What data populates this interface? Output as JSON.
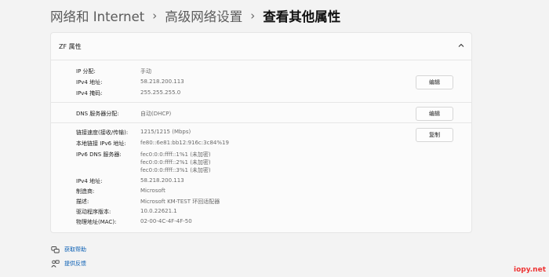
{
  "breadcrumb": {
    "items": [
      {
        "label": "网络和 Internet"
      },
      {
        "label": "高级网络设置"
      },
      {
        "label": "查看其他属性"
      }
    ],
    "separator": "›"
  },
  "panel": {
    "title": "ZF 属性",
    "section1": {
      "ip_label": "IP 分配:",
      "ip_value": "手动",
      "ipv4_label": "IPv4 地址:",
      "ipv4_value": "58.218.200.113",
      "mask_label": "IPv4 掩码:",
      "mask_value": "255.255.255.0",
      "edit_label": "编辑"
    },
    "section2": {
      "dns_label": "DNS 服务器分配:",
      "dns_value": "自动(DHCP)",
      "edit_label": "编辑"
    },
    "section3": {
      "copy_label": "复制",
      "link_speed_label": "链接速度(接收/传输):",
      "link_speed_value": "1215/1215 (Mbps)",
      "ipv6_local_label": "本地链接 IPv6 地址:",
      "ipv6_local_value": "fe80::6e81:bb12:916c:3c84%19",
      "ipv6_dns_label": "IPv6 DNS 服务器:",
      "ipv6_dns_values": [
        "fec0:0:0:ffff::1%1 (未加密)",
        "fec0:0:0:ffff::2%1 (未加密)",
        "fec0:0:0:ffff::3%1 (未加密)"
      ],
      "ipv4_label": "IPv4 地址:",
      "ipv4_value": "58.218.200.113",
      "manufacturer_label": "制造商:",
      "manufacturer_value": "Microsoft",
      "description_label": "描述:",
      "description_value": "Microsoft KM-TEST 环回适配器",
      "driver_label": "驱动程序版本:",
      "driver_value": "10.0.22621.1",
      "mac_label": "物理地址(MAC):",
      "mac_value": "02-00-4C-4F-4F-50"
    }
  },
  "footer": {
    "help_label": "获取帮助",
    "feedback_label": "提供反馈"
  },
  "watermark": "iopy.net",
  "icons": {
    "chevron": "chevron-up-icon",
    "help": "help-icon",
    "feedback": "feedback-icon"
  },
  "colors": {
    "link": "#0a5fb4",
    "background": "#f3f3f3",
    "card": "#fbfbfb"
  }
}
